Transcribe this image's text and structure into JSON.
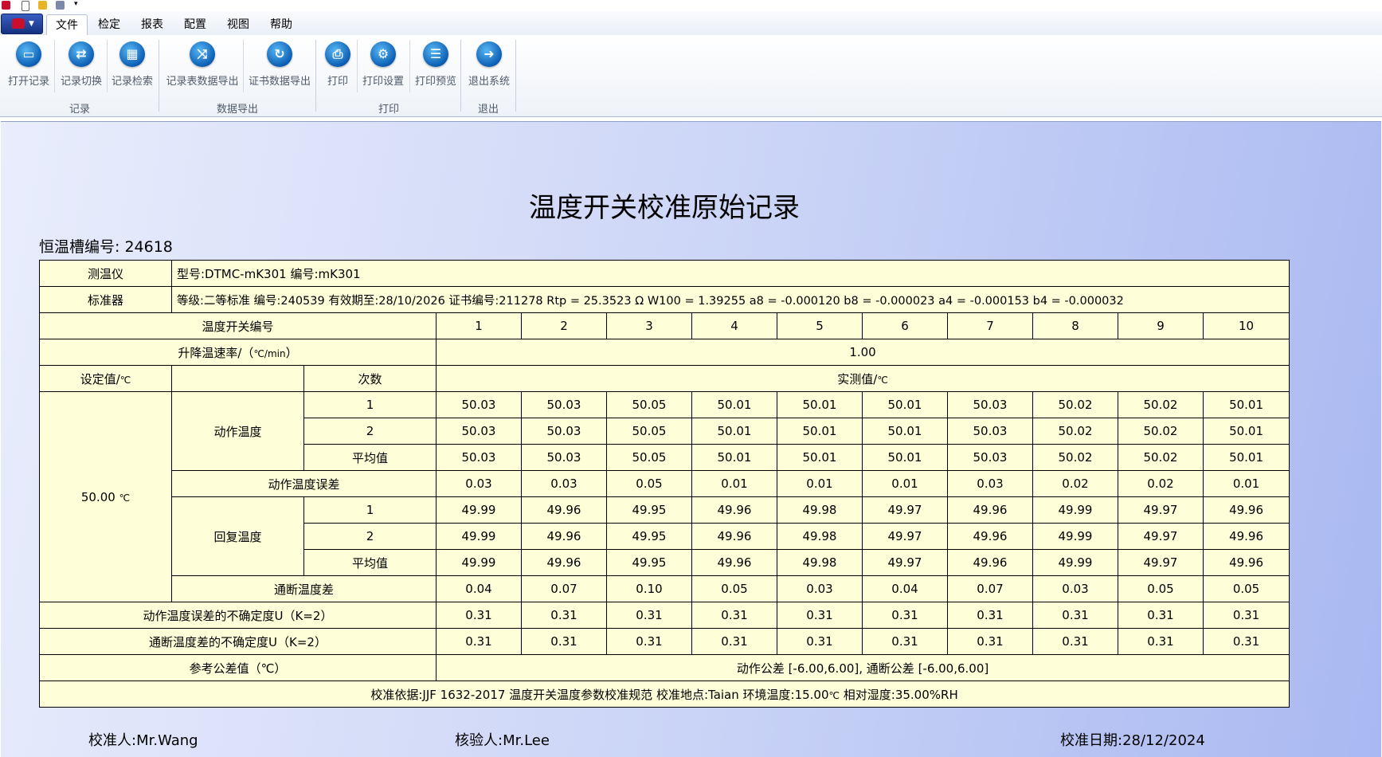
{
  "menu": {
    "tabs": [
      "文件",
      "检定",
      "报表",
      "配置",
      "视图",
      "帮助"
    ],
    "active_tab": "文件"
  },
  "ribbon": {
    "groups": [
      {
        "label": "记录",
        "buttons": [
          {
            "label": "打开记录",
            "icon": "folder-icon"
          },
          {
            "label": "记录切换",
            "icon": "switch-icon"
          },
          {
            "label": "记录检索",
            "icon": "calendar-icon"
          }
        ]
      },
      {
        "label": "数据导出",
        "buttons": [
          {
            "label": "记录表数据导出",
            "icon": "shuffle-icon"
          },
          {
            "label": "证书数据导出",
            "icon": "refresh-icon"
          }
        ]
      },
      {
        "label": "打印",
        "buttons": [
          {
            "label": "打印",
            "icon": "printer-icon"
          },
          {
            "label": "打印设置",
            "icon": "gear-icon"
          },
          {
            "label": "打印预览",
            "icon": "document-icon"
          }
        ]
      },
      {
        "label": "退出",
        "buttons": [
          {
            "label": "退出系统",
            "icon": "runner-icon"
          }
        ]
      }
    ]
  },
  "report": {
    "title": "温度开关校准原始记录",
    "bath_label": "恒温槽编号:",
    "bath_no": "24618",
    "thermometer_label": "测温仪",
    "thermometer_info": "型号:DTMC-mK301  编号:mK301",
    "standard_label": "标准器",
    "standard_info": "等级:二等标准  编号:240539  有效期至:28/10/2026  证书编号:211278  Rtp =  25.3523 Ω  W100 = 1.39255  a8 = -0.000120  b8 = -0.000023  a4 = -0.000153  b4 = -0.000032",
    "switch_no_label": "温度开关编号",
    "switch_nos": [
      "1",
      "2",
      "3",
      "4",
      "5",
      "6",
      "7",
      "8",
      "9",
      "10"
    ],
    "rate_label": "升降温速率/（",
    "rate_unit": "℃/min",
    "rate_close": "）",
    "rate_value": "1.00",
    "setpoint_label": "设定值/",
    "setpoint_unit": "℃",
    "times_label": "次数",
    "measured_label": "实测值/",
    "measured_unit": "℃",
    "setpoint_value": "50.00",
    "setpoint_value_unit": "℃",
    "action_temp_label": "动作温度",
    "reset_temp_label": "回复温度",
    "avg_label": "平均值",
    "run1": "1",
    "run2": "2",
    "action_run1": [
      "50.03",
      "50.03",
      "50.05",
      "50.01",
      "50.01",
      "50.01",
      "50.03",
      "50.02",
      "50.02",
      "50.01"
    ],
    "action_run2": [
      "50.03",
      "50.03",
      "50.05",
      "50.01",
      "50.01",
      "50.01",
      "50.03",
      "50.02",
      "50.02",
      "50.01"
    ],
    "action_avg": [
      "50.03",
      "50.03",
      "50.05",
      "50.01",
      "50.01",
      "50.01",
      "50.03",
      "50.02",
      "50.02",
      "50.01"
    ],
    "action_error_label": "动作温度误差",
    "action_error": [
      "0.03",
      "0.03",
      "0.05",
      "0.01",
      "0.01",
      "0.01",
      "0.03",
      "0.02",
      "0.02",
      "0.01"
    ],
    "reset_run1": [
      "49.99",
      "49.96",
      "49.95",
      "49.96",
      "49.98",
      "49.97",
      "49.96",
      "49.99",
      "49.97",
      "49.96"
    ],
    "reset_run2": [
      "49.99",
      "49.96",
      "49.95",
      "49.96",
      "49.98",
      "49.97",
      "49.96",
      "49.99",
      "49.97",
      "49.96"
    ],
    "reset_avg": [
      "49.99",
      "49.96",
      "49.95",
      "49.96",
      "49.98",
      "49.97",
      "49.96",
      "49.99",
      "49.97",
      "49.96"
    ],
    "diff_label": "通断温度差",
    "diff": [
      "0.04",
      "0.07",
      "0.10",
      "0.05",
      "0.03",
      "0.04",
      "0.07",
      "0.03",
      "0.05",
      "0.05"
    ],
    "u_action_label": "动作温度误差的不确定度U（K=2）",
    "u_action": [
      "0.31",
      "0.31",
      "0.31",
      "0.31",
      "0.31",
      "0.31",
      "0.31",
      "0.31",
      "0.31",
      "0.31"
    ],
    "u_diff_label": "通断温度差的不确定度U（K=2）",
    "u_diff": [
      "0.31",
      "0.31",
      "0.31",
      "0.31",
      "0.31",
      "0.31",
      "0.31",
      "0.31",
      "0.31",
      "0.31"
    ],
    "tolerance_label": "参考公差值（℃）",
    "tolerance_value": "动作公差 [-6.00,6.00],  通断公差 [-6.00,6.00]",
    "basis_text": "校准依据:JJF 1632-2017 温度开关温度参数校准规范    校准地点:Taian    环境温度:15.00",
    "basis_unit": "℃",
    "basis_humidity": "    相对湿度:35.00%RH",
    "calibrator_label": "校准人:",
    "calibrator": "Mr.Wang",
    "checker_label": "核验人:",
    "checker": "Mr.Lee",
    "date_label": "校准日期:",
    "date": "28/12/2024"
  }
}
